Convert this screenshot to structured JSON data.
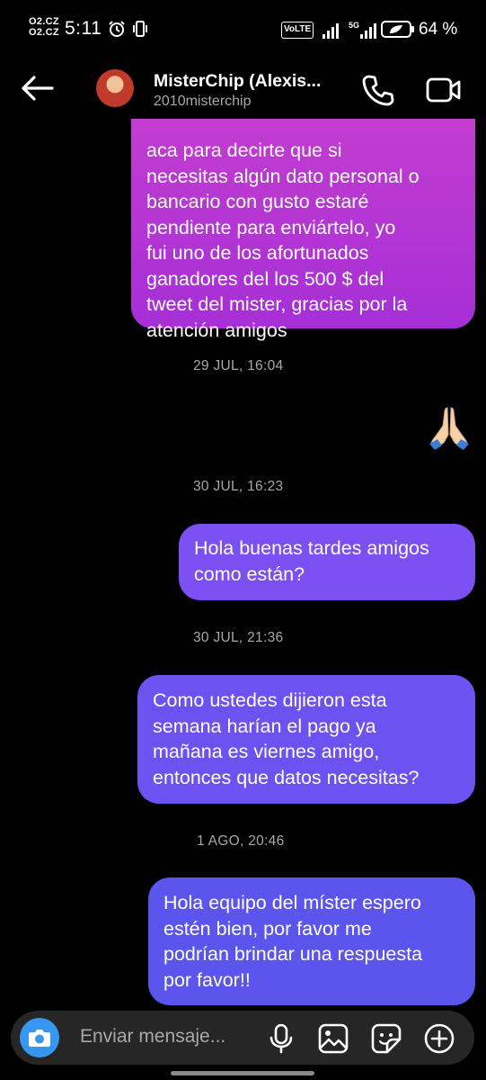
{
  "status_bar": {
    "carrier_line1": "O2.CZ",
    "carrier_line2": "O2.CZ",
    "time": "5:11",
    "volte": "VoLTE",
    "network": "5G",
    "battery_percent": "64 %"
  },
  "header": {
    "display_name": "MisterChip (Alexis...",
    "username": "2010misterchip"
  },
  "messages": [
    {
      "type": "outgoing",
      "text": "aca para decirte que si\nnecesitas algún dato personal o\nbancario con gusto estaré\npendiente para enviártelo, yo\nfui uno de los afortunados\nganadores del los 500 $ del\ntweet del mister, gracias por la\natención amigos"
    },
    {
      "type": "timestamp",
      "text": "29 JUL, 16:04"
    },
    {
      "type": "emoji",
      "name": "folded-hands-emoji",
      "text": "🙏"
    },
    {
      "type": "timestamp",
      "text": "30 JUL, 16:23"
    },
    {
      "type": "outgoing",
      "text": "Hola buenas tardes amigos\ncomo están?"
    },
    {
      "type": "timestamp",
      "text": "30 JUL, 21:36"
    },
    {
      "type": "outgoing",
      "text": "Como ustedes dijieron esta\nsemana harían el pago ya\nmañana es viernes amigo,\nentonces que datos necesitas?"
    },
    {
      "type": "timestamp",
      "text": "1 AGO, 20:46"
    },
    {
      "type": "outgoing",
      "text": "Hola equipo del míster espero\nestén bien, por favor me\npodrían brindar una respuesta\npor favor!!"
    }
  ],
  "composer": {
    "placeholder": "Enviar mensaje...",
    "icons": [
      "camera-icon",
      "microphone-icon",
      "gallery-icon",
      "sticker-icon",
      "plus-icon"
    ]
  },
  "colors": {
    "background": "#000000",
    "bubble_1": "#b536d3",
    "bubble_2": "#7b4ff2",
    "bubble_3": "#6c52f1",
    "bubble_4": "#5b55ee",
    "camera_button": "#3797f0",
    "composer": "#262626"
  }
}
